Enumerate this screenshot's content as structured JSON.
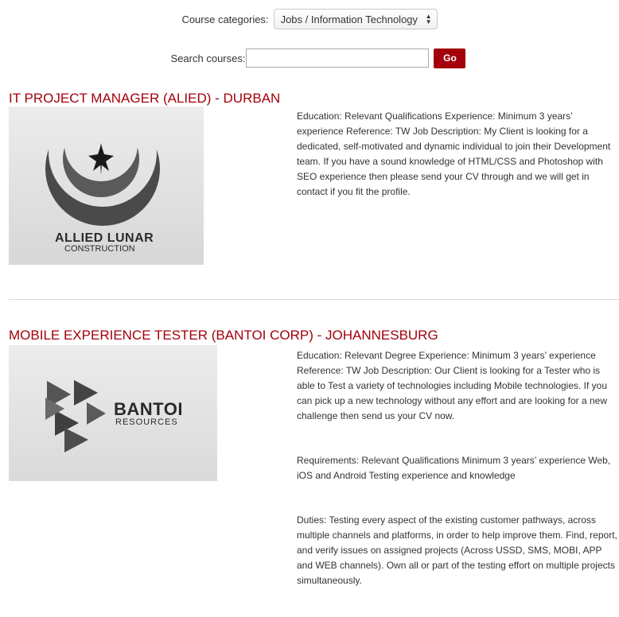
{
  "filters": {
    "category_label": "Course categories:",
    "category_selected": "Jobs / Information Technology",
    "search_label": "Search courses:",
    "search_value": "",
    "go_label": "Go"
  },
  "courses": [
    {
      "title": "IT PROJECT MANAGER (ALIED) - DURBAN",
      "logo": {
        "name": "ALLIED LUNAR",
        "sub": "CONSTRUCTION"
      },
      "paragraphs": [
        "Education: Relevant Qualifications Experience: Minimum 3 years’ experience Reference: TW Job Description: My Client is looking for a dedicated, self-motivated and dynamic individual to join their Development team. If you have a sound knowledge of HTML/CSS and Photoshop with SEO experience then please send your CV through and we will get in contact if you fit the profile."
      ]
    },
    {
      "title": "MOBILE EXPERIENCE TESTER (BANTOI CORP) - JOHANNESBURG",
      "logo": {
        "name": "BANTOI",
        "sub": "RESOURCES"
      },
      "paragraphs": [
        "Education: Relevant Degree Experience: Minimum 3 years’ experience Reference: TW Job Description: Our Client is looking for a Tester who is able to Test a variety of technologies including Mobile technologies. If you can pick up a new technology without any effort and are looking for a new challenge then send us your CV now.",
        "Requirements: Relevant Qualifications Minimum 3 years’ experience Web, iOS and Android Testing experience and knowledge",
        "Duties: Testing every aspect of the existing customer pathways, across multiple channels and platforms, in order to help improve them. Find, report, and verify issues on assigned projects (Across USSD, SMS, MOBI, APP and WEB channels). Own all or part of the testing effort on multiple projects simultaneously."
      ]
    }
  ],
  "colors": {
    "accent": "#a3000b",
    "text": "#333333",
    "divider": "#d9d9d9"
  }
}
